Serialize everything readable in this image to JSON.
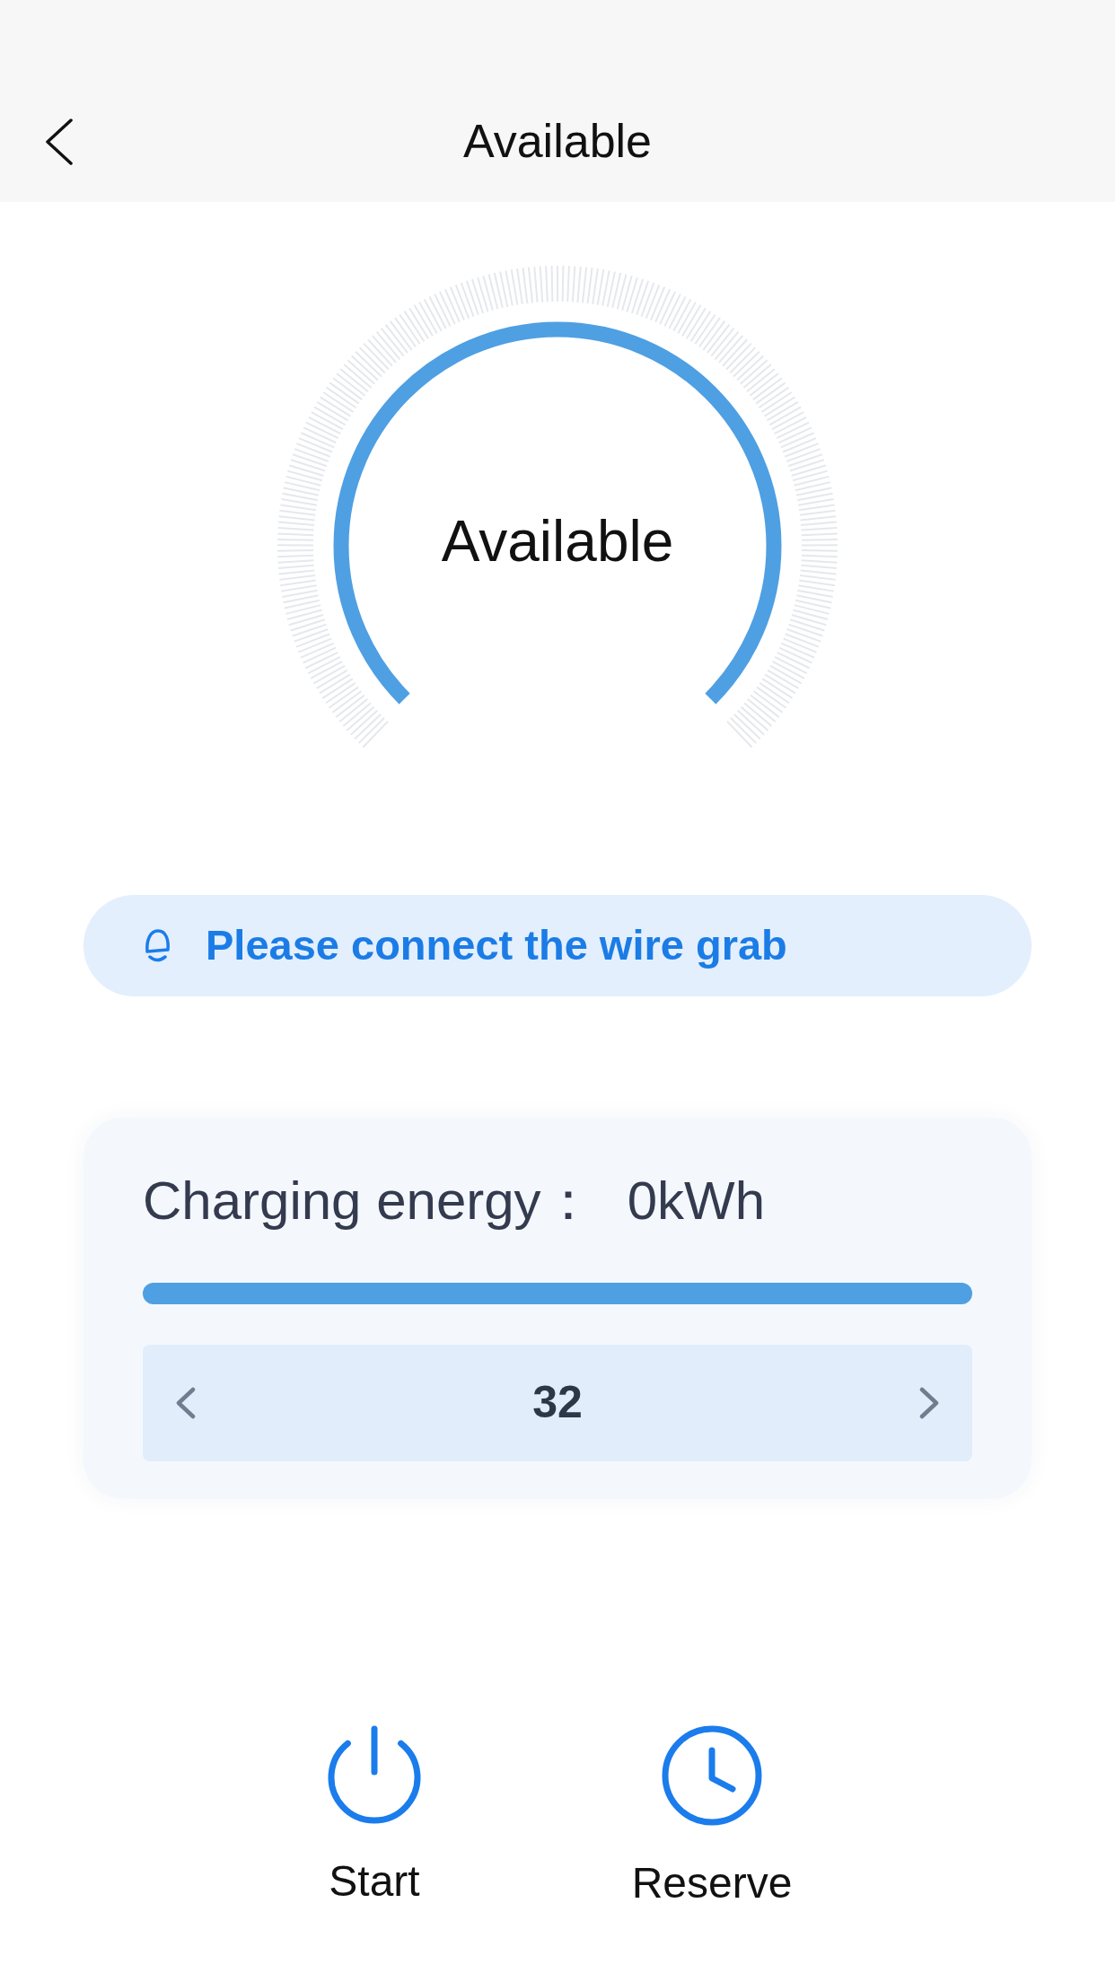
{
  "header": {
    "title": "Available"
  },
  "gauge": {
    "status": "Available"
  },
  "notice": {
    "text": "Please connect the wire grab"
  },
  "energy_card": {
    "label": "Charging energy：",
    "value": "0kWh",
    "stepper": {
      "value": "32"
    }
  },
  "actions": [
    {
      "kind": "power",
      "label": "Start"
    },
    {
      "kind": "clock",
      "label": "Reserve"
    }
  ]
}
